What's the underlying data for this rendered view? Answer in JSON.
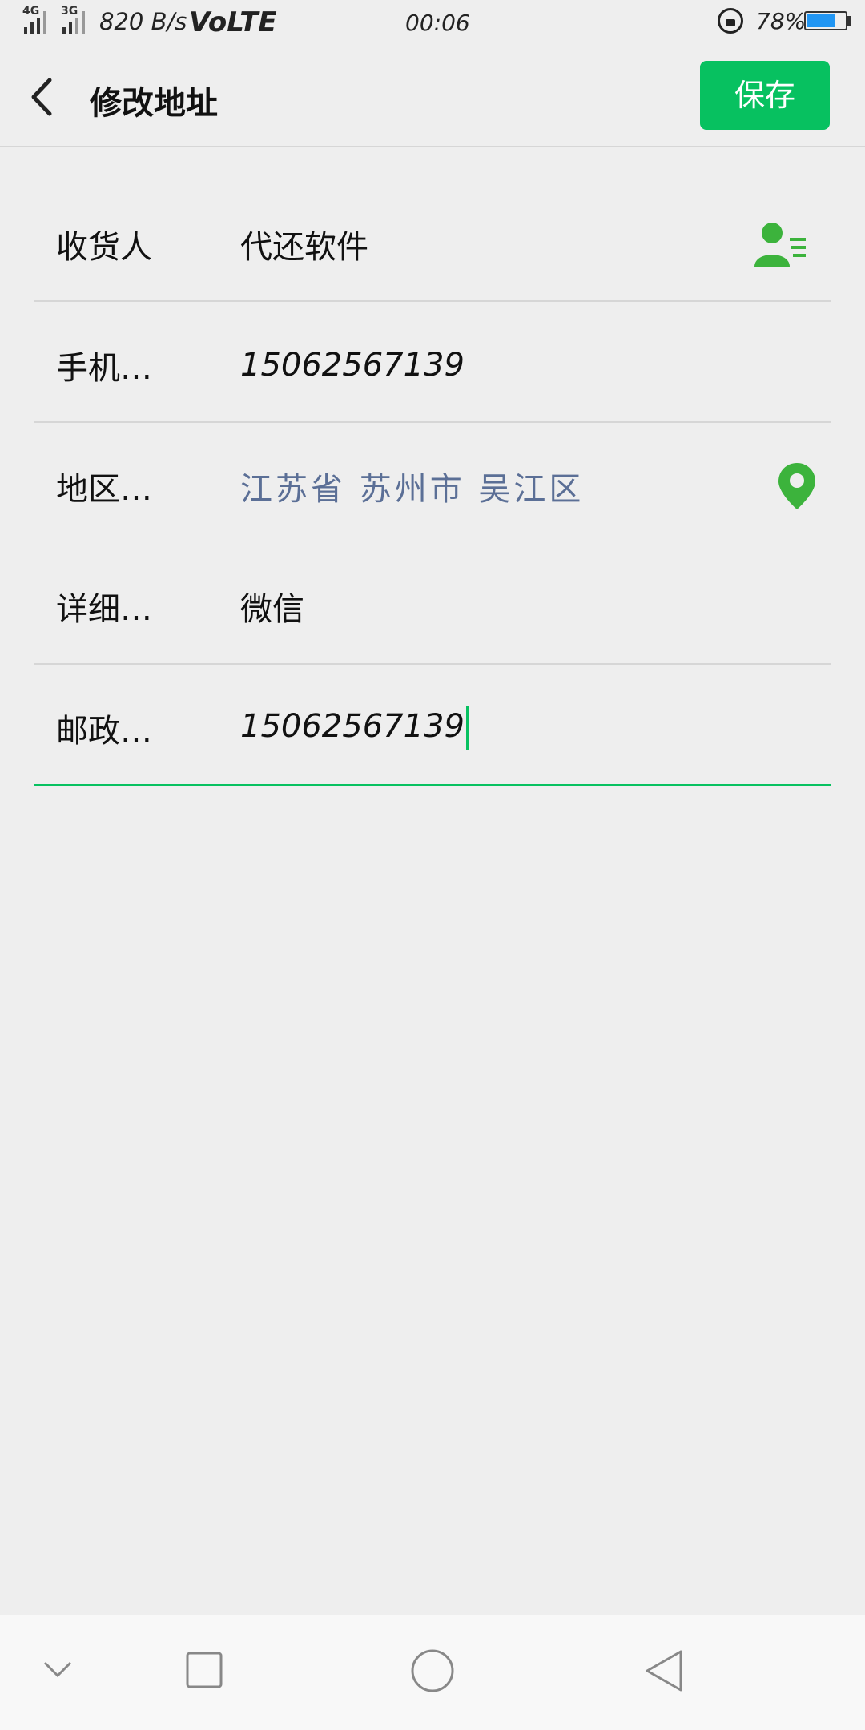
{
  "status_bar": {
    "net_type_1": "4G",
    "net_type_2": "3G",
    "speed": "820 B/s",
    "volte": "VoLTE",
    "time": "00:06",
    "battery_pct": "78%",
    "battery_level": 0.78,
    "battery_color": "#2196f3"
  },
  "header": {
    "title": "修改地址",
    "save_label": "保存",
    "accent": "#07c160"
  },
  "form": {
    "consignee": {
      "label": "收货人",
      "value": "代还软件",
      "icon": "contact-list-icon"
    },
    "phone": {
      "label": "手机…",
      "value": "15062567139"
    },
    "region": {
      "label": "地区…",
      "value": "江苏省 苏州市 吴江区",
      "icon": "location-pin-icon"
    },
    "detail": {
      "label": "详细…",
      "value": "微信"
    },
    "postcode": {
      "label": "邮政…",
      "value": "15062567139"
    }
  },
  "navbar": {
    "icons": [
      "collapse-chevron-icon",
      "recent-apps-icon",
      "home-circle-icon",
      "back-triangle-icon"
    ]
  }
}
